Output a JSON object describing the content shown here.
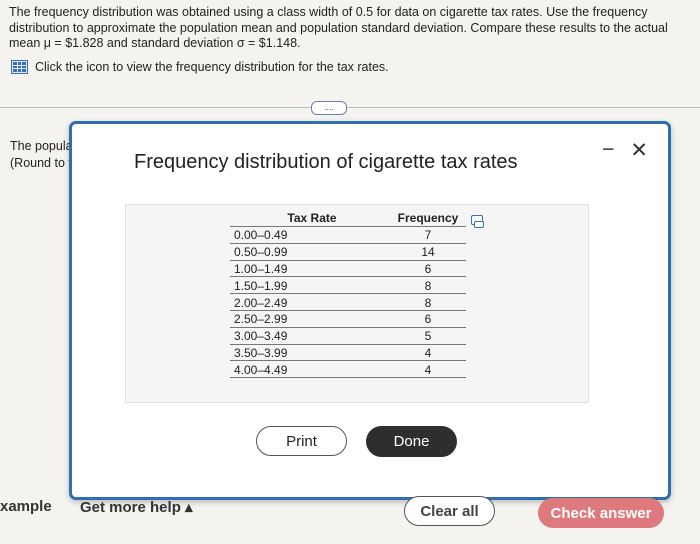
{
  "question": {
    "text": "The frequency distribution was obtained using a class width of 0.5 for data on cigarette tax rates. Use the frequency distribution to approximate the population mean and population standard deviation. Compare these results to the actual mean μ = $1.828 and standard deviation σ = $1.148.",
    "icon_instruction": "Click the icon to view the frequency distribution for the tax rates.",
    "icon": "table-grid-icon"
  },
  "more_button": "....",
  "background_partial": {
    "line1": "The popula",
    "line2": "(Round to t"
  },
  "modal": {
    "title": "Frequency distribution of cigarette tax rates",
    "minimize": "−",
    "close": "✕",
    "table": {
      "headers": [
        "Tax Rate",
        "Frequency"
      ],
      "rows": [
        [
          "0.00–0.49",
          "7"
        ],
        [
          "0.50–0.99",
          "14"
        ],
        [
          "1.00–1.49",
          "6"
        ],
        [
          "1.50–1.99",
          "8"
        ],
        [
          "2.00–2.49",
          "8"
        ],
        [
          "2.50–2.99",
          "6"
        ],
        [
          "3.00–3.49",
          "5"
        ],
        [
          "3.50–3.99",
          "4"
        ],
        [
          "4.00–4.49",
          "4"
        ]
      ]
    },
    "print_label": "Print",
    "done_label": "Done"
  },
  "footer": {
    "example_label": "xample",
    "help_label": "Get more help ▴",
    "clear_label": "Clear all",
    "check_label": "Check answer"
  },
  "colors": {
    "accent": "#2f6fb1",
    "check_button": "#de7a7e",
    "done_button": "#2e2e2e"
  }
}
